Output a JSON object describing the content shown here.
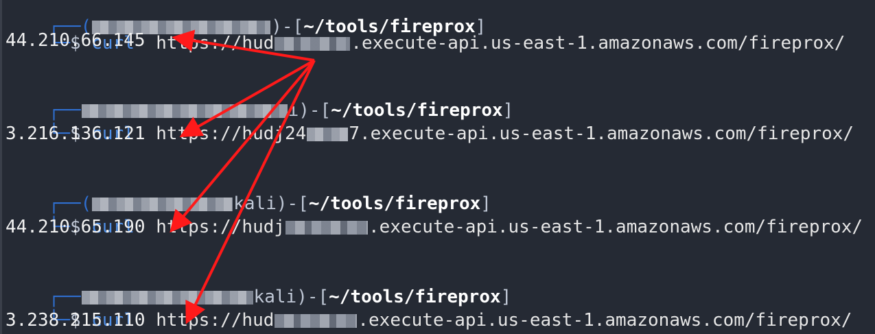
{
  "terminal": {
    "cmd": "curl",
    "prompt_symbol": "$",
    "entries": [
      {
        "header_user": "",
        "header_path": "",
        "url_prefix": "https://hud",
        "url_suffix": ".execute-api.us-east-1.amazonaws.com/fireprox/",
        "ip": "44.210.66.145"
      },
      {
        "header_user": "i)-[",
        "header_path": "~/tools/fireprox",
        "url_prefix": "https://hudj24",
        "url_suffix": "7.execute-api.us-east-1.amazonaws.com/fireprox/",
        "ip": "3.216.136.121"
      },
      {
        "header_user": "kali)-[",
        "header_path": "~/tools/fireprox",
        "url_prefix": "https://hudj",
        "url_suffix": ".execute-api.us-east-1.amazonaws.com/fireprox/",
        "ip": "44.210.65.190"
      },
      {
        "header_user": "kali)-[",
        "header_path": "~/tools/fireprox",
        "url_prefix": "https://hud",
        "url_suffix": ".execute-api.us-east-1.amazonaws.com/fireprox/",
        "ip": "3.238.215.110"
      }
    ],
    "bracket_close": "]"
  },
  "colors": {
    "background": "#252a34",
    "arrow": "#ff1a1a",
    "prompt_box": "#2f6fd0",
    "command": "#4f8fe6"
  }
}
